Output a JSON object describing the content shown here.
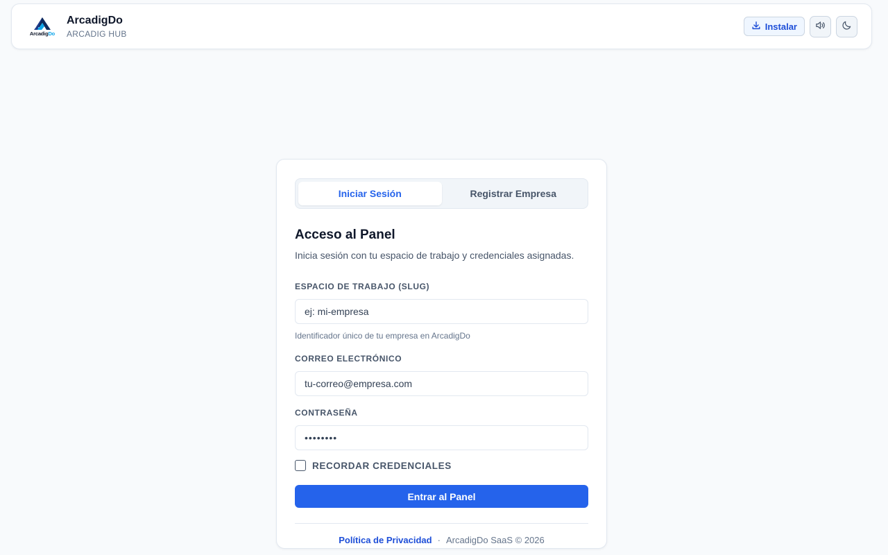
{
  "header": {
    "logo_text_main": "Arcadig",
    "logo_text_accent": "Do",
    "brand_name": "ArcadigDo",
    "brand_subtitle": "ARCADIG HUB",
    "install_label": "Instalar",
    "icons": {
      "install": "download-icon",
      "sound": "speaker-icon",
      "theme": "moon-icon"
    }
  },
  "auth": {
    "tabs": [
      {
        "label": "Iniciar Sesión",
        "active": true
      },
      {
        "label": "Registrar Empresa",
        "active": false
      }
    ],
    "title": "Acceso al Panel",
    "subtitle": "Inicia sesión con tu espacio de trabajo y credenciales asignadas.",
    "workspace": {
      "label": "ESPACIO DE TRABAJO (SLUG)",
      "placeholder": "ej: mi-empresa",
      "value": "",
      "hint": "Identificador único de tu empresa en ArcadigDo"
    },
    "email": {
      "label": "CORREO ELECTRÓNICO",
      "placeholder": "tu-correo@empresa.com",
      "value": ""
    },
    "password": {
      "label": "CONTRASEÑA",
      "placeholder": "••••••••",
      "value": ""
    },
    "remember": {
      "label": "RECORDAR CREDENCIALES",
      "checked": false
    },
    "submit_label": "Entrar al Panel",
    "footer": {
      "privacy_label": "Política de Privacidad",
      "separator": "·",
      "copyright": "ArcadigDo SaaS © 2026"
    }
  },
  "colors": {
    "primary": "#2563eb",
    "page_background": "#f8fafc",
    "text_dark": "#0f172a",
    "text_muted": "#64748b"
  }
}
